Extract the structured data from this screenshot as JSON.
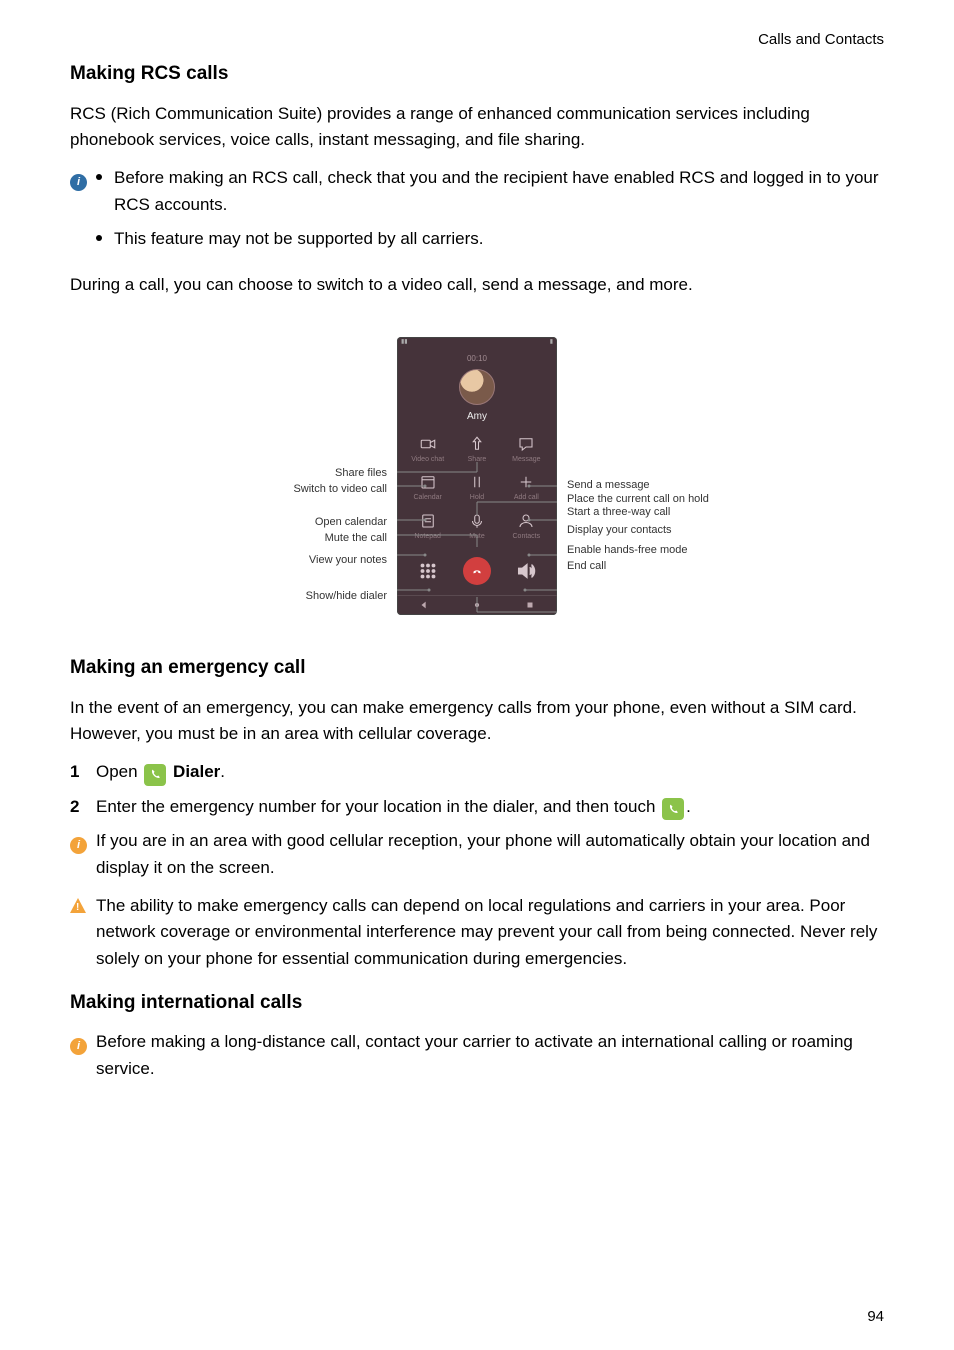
{
  "header": {
    "section": "Calls and Contacts"
  },
  "page_number": "94",
  "rcs": {
    "heading": "Making RCS calls",
    "intro": "RCS (Rich Communication Suite) provides a range of enhanced communication services including phonebook services, voice calls, instant messaging, and file sharing.",
    "info_bullets": [
      "Before making an RCS call, check that you and the recipient have enabled RCS and logged in to your RCS accounts.",
      "This feature may not be supported by all carriers."
    ],
    "during_call": "During a call, you can choose to switch to a video call, send a message, and more."
  },
  "emergency": {
    "heading": "Making an emergency call",
    "intro": "In the event of an emergency, you can make emergency calls from your phone, even without a SIM card. However, you must be in an area with cellular coverage.",
    "steps": [
      {
        "num": "1",
        "pre": "Open ",
        "bold": "Dialer",
        "post": "."
      },
      {
        "num": "2",
        "pre": "Enter the emergency number for your location in the dialer, and then touch ",
        "post": "."
      }
    ],
    "note": "If you are in an area with good cellular reception, your phone will automatically obtain your location and display it on the screen.",
    "warn": "The ability to make emergency calls can depend on local regulations and carriers in your area. Poor network coverage or environmental interference may prevent your call from being connected. Never rely solely on your phone for essential communication during emergencies."
  },
  "intl": {
    "heading": "Making international calls",
    "note": "Before making a long-distance call, contact your carrier to activate an international calling or roaming service."
  },
  "phone": {
    "timer": "00:10",
    "caller": "Amy",
    "grid": [
      {
        "label": "Video chat"
      },
      {
        "label": "Share"
      },
      {
        "label": "Message"
      },
      {
        "label": "Calendar"
      },
      {
        "label": "Hold"
      },
      {
        "label": "Add call"
      },
      {
        "label": "Notepad"
      },
      {
        "label": "Mute"
      },
      {
        "label": "Contacts"
      }
    ],
    "callouts_left": [
      "Share files",
      "Switch to video call",
      "Open calendar",
      "Mute the call",
      "View your notes",
      "Show/hide dialer"
    ],
    "callouts_right": [
      "Send a message",
      "Place the current call on hold",
      "Start a three-way call",
      "Display your contacts",
      "Enable hands-free mode",
      "End call"
    ]
  }
}
